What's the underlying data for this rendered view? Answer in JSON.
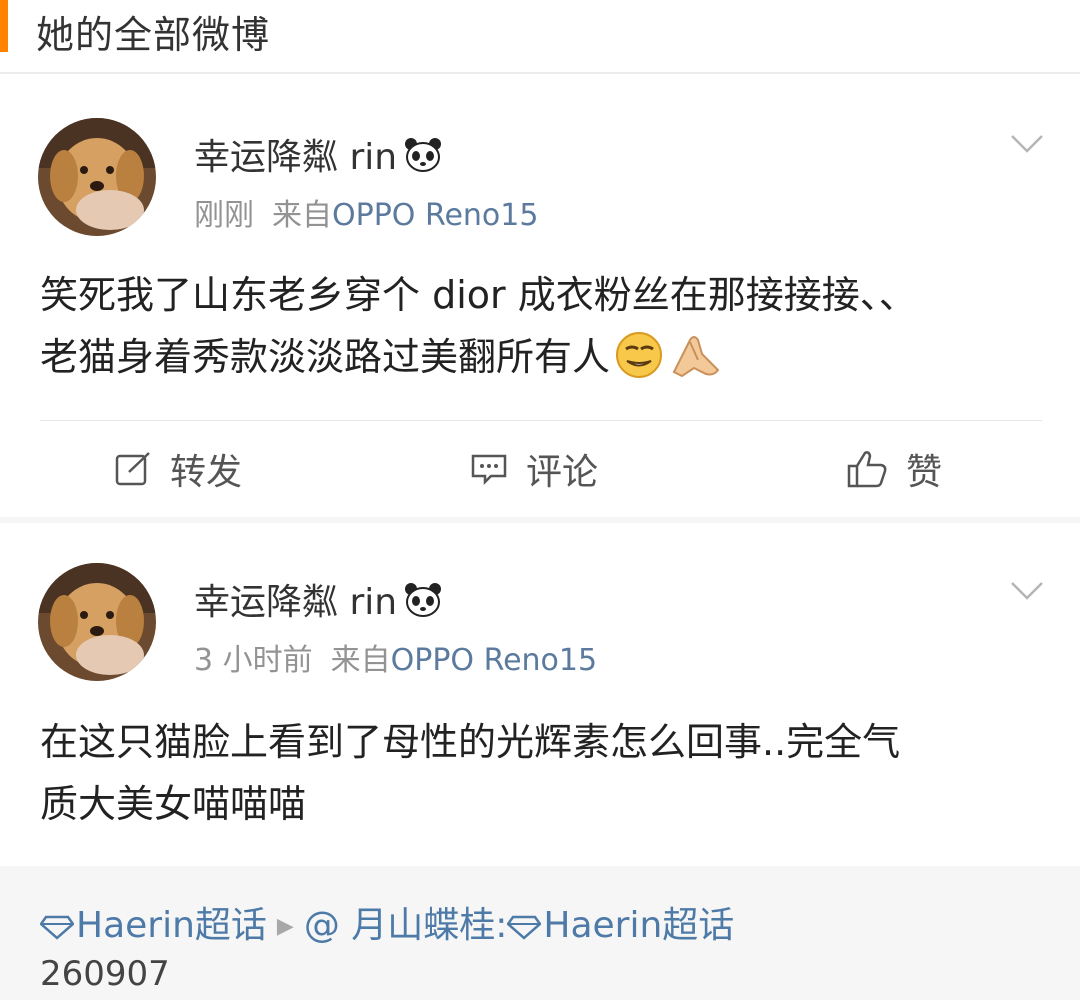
{
  "header": {
    "title": "她的全部微博"
  },
  "posts": [
    {
      "username": "幸运降粼 rin",
      "time": "刚刚",
      "source_prefix": "来自",
      "source": "OPPO Reno15",
      "content_line1": "笑死我了山东老乡穿个 dior 成衣粉丝在那接接接、、",
      "content_line2": "老猫身着秀款淡淡路过美翻所有人",
      "emojis": [
        "smirk-emoji",
        "pray-hands-emoji"
      ]
    },
    {
      "username": "幸运降粼 rin",
      "time": "3 小时前",
      "source_prefix": "来自",
      "source": "OPPO Reno15",
      "content_line1": "在这只猫脸上看到了母性的光辉素怎么回事..完全气",
      "content_line2": "质大美女喵喵喵"
    }
  ],
  "actions": {
    "repost": "转发",
    "comment": "评论",
    "like": "赞"
  },
  "topic": {
    "name": "Haerin超话",
    "mention": "@ 月山蝶桂:",
    "name2": "Haerin超话",
    "number": "260907"
  },
  "colors": {
    "accent": "#ff8200",
    "link": "#4e7aa8",
    "source": "#5b7a9d"
  }
}
